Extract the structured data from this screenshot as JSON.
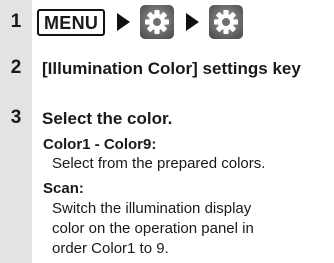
{
  "steps": [
    {
      "number": "1",
      "menu_key": "MENU",
      "icons": [
        "settings-gear-icon",
        "settings-gear-icon"
      ]
    },
    {
      "number": "2",
      "title": "[Illumination Color] settings key"
    },
    {
      "number": "3",
      "title": "Select the color.",
      "items": [
        {
          "heading": "Color1 - Color9:",
          "lines": [
            "Select from the prepared colors."
          ]
        },
        {
          "heading": "Scan:",
          "lines": [
            "Switch the illumination display",
            "color on the operation panel in",
            "order Color1 to 9."
          ]
        }
      ]
    }
  ],
  "colors": {
    "gutter": "#e3e3e3",
    "text": "#1a1a1a",
    "gear_tile": "#6f6f6f"
  }
}
